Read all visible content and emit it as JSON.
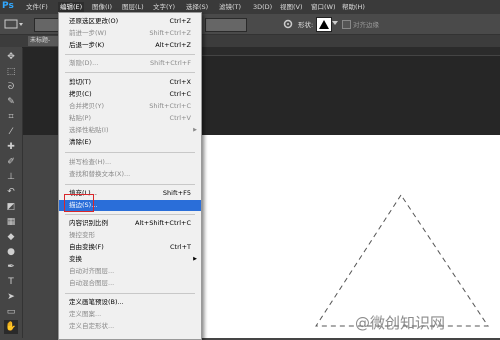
{
  "app": {
    "logo": "Ps"
  },
  "menubar": {
    "items": [
      "文件(F)",
      "编辑(E)",
      "图像(I)",
      "图层(L)",
      "文字(Y)",
      "选择(S)",
      "滤镜(T)",
      "3D(D)",
      "视图(V)",
      "窗口(W)",
      "帮助(H)"
    ]
  },
  "options_bar": {
    "shape_label": "形状:",
    "align_label": "对齐边缘"
  },
  "document_tab": {
    "title": "未标题-"
  },
  "edit_menu": {
    "items": [
      {
        "label": "还原选区更改(O)",
        "shortcut": "Ctrl+Z",
        "disabled": false
      },
      {
        "label": "前进一步(W)",
        "shortcut": "Shift+Ctrl+Z",
        "disabled": true
      },
      {
        "label": "后退一步(K)",
        "shortcut": "Alt+Ctrl+Z",
        "disabled": false
      },
      {
        "label": "渐隐(D)...",
        "shortcut": "Shift+Ctrl+F",
        "disabled": true
      },
      {
        "label": "剪切(T)",
        "shortcut": "Ctrl+X",
        "disabled": false
      },
      {
        "label": "拷贝(C)",
        "shortcut": "Ctrl+C",
        "disabled": false
      },
      {
        "label": "合并拷贝(Y)",
        "shortcut": "Shift+Ctrl+C",
        "disabled": true
      },
      {
        "label": "粘贴(P)",
        "shortcut": "Ctrl+V",
        "disabled": true
      },
      {
        "label": "选择性粘贴(I)",
        "shortcut": "",
        "disabled": true,
        "submenu": true
      },
      {
        "label": "清除(E)",
        "shortcut": "",
        "disabled": false
      },
      {
        "label": "拼写检查(H)...",
        "shortcut": "",
        "disabled": true
      },
      {
        "label": "查找和替换文本(X)...",
        "shortcut": "",
        "disabled": true
      },
      {
        "label": "填充(L)...",
        "shortcut": "Shift+F5",
        "disabled": false
      },
      {
        "label": "描边(S)...",
        "shortcut": "",
        "disabled": false,
        "highlight": true
      },
      {
        "label": "内容识别比例",
        "shortcut": "Alt+Shift+Ctrl+C",
        "disabled": false
      },
      {
        "label": "操控变形",
        "shortcut": "",
        "disabled": true
      },
      {
        "label": "自由变换(F)",
        "shortcut": "Ctrl+T",
        "disabled": false
      },
      {
        "label": "变换",
        "shortcut": "",
        "disabled": false,
        "submenu": true
      },
      {
        "label": "自动对齐图层...",
        "shortcut": "",
        "disabled": true
      },
      {
        "label": "自动混合图层...",
        "shortcut": "",
        "disabled": true
      },
      {
        "label": "定义画笔预设(B)...",
        "shortcut": "",
        "disabled": false
      },
      {
        "label": "定义图案...",
        "shortcut": "",
        "disabled": true
      },
      {
        "label": "定义自定形状...",
        "shortcut": "",
        "disabled": true
      }
    ]
  },
  "watermark": {
    "text": "@微创知识网"
  },
  "colors": {
    "highlight": "#2a6ed9",
    "red_box": "#d9262a",
    "ps_blue": "#31a8ff"
  },
  "icons": [
    "move-icon",
    "marquee-icon",
    "lasso-icon",
    "quick-select-icon",
    "crop-icon",
    "eyedropper-icon",
    "healing-icon",
    "brush-icon",
    "stamp-icon",
    "history-brush-icon",
    "eraser-icon",
    "gradient-icon",
    "blur-icon",
    "dodge-icon",
    "pen-icon",
    "type-icon",
    "path-select-icon",
    "shape-icon"
  ]
}
